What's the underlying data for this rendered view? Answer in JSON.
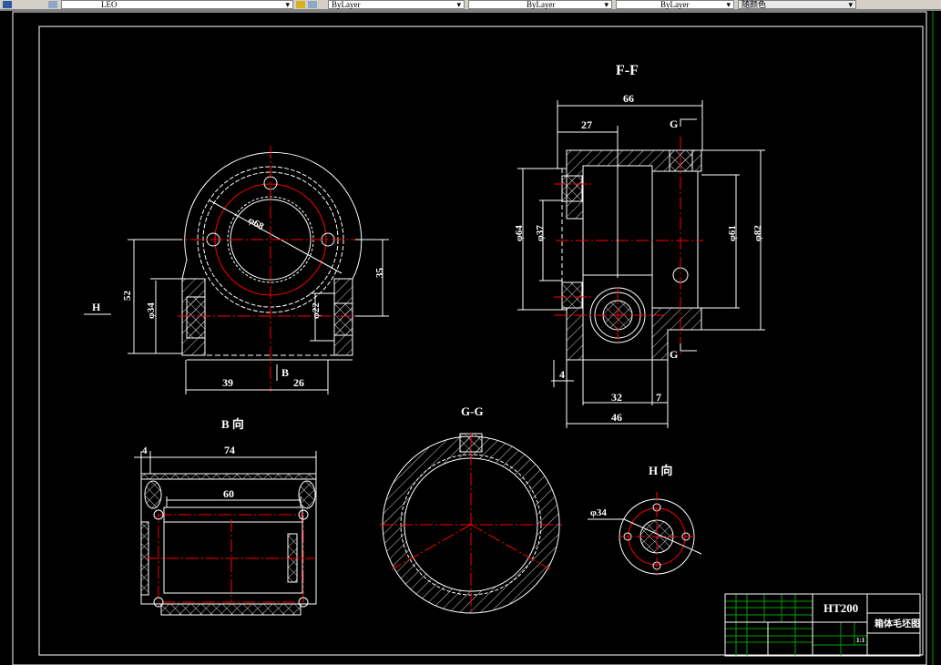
{
  "toolbar": {
    "layer_value": "LEO",
    "color_value": "ByLayer",
    "linetype_value": "ByLayer",
    "lineweight_value": "ByLayer",
    "plotstyle_value": "随颜色"
  },
  "colors": {
    "background": "#000000",
    "lines": "#ffffff",
    "centerlines": "#ff0000",
    "title_grid": "#00a000"
  },
  "drawing": {
    "front_view": {
      "dims": {
        "d68": "φ68",
        "h52": "52",
        "d34": "φ34",
        "d22": "φ22",
        "h35": "35",
        "w39": "39",
        "w26": "26"
      },
      "arrow_h": "H",
      "arrow_b": "B"
    },
    "section_ff": {
      "title": "F-F",
      "dims": {
        "w66": "66",
        "w27": "27",
        "d64": "φ64",
        "d37": "φ37",
        "d61": "φ61",
        "d82": "φ82",
        "w4": "4",
        "w32": "32",
        "w7": "7",
        "w46": "46"
      },
      "cut_label": "G"
    },
    "view_b": {
      "title": "B 向",
      "dims": {
        "w4": "4",
        "w74": "74",
        "w60": "60"
      }
    },
    "section_gg": {
      "title": "G-G"
    },
    "view_h": {
      "title": "H 向",
      "dims": {
        "d34": "φ34"
      }
    }
  },
  "title_block": {
    "material": "HT200",
    "drawing_name": "箱体毛坯图",
    "scale": "1:1"
  }
}
